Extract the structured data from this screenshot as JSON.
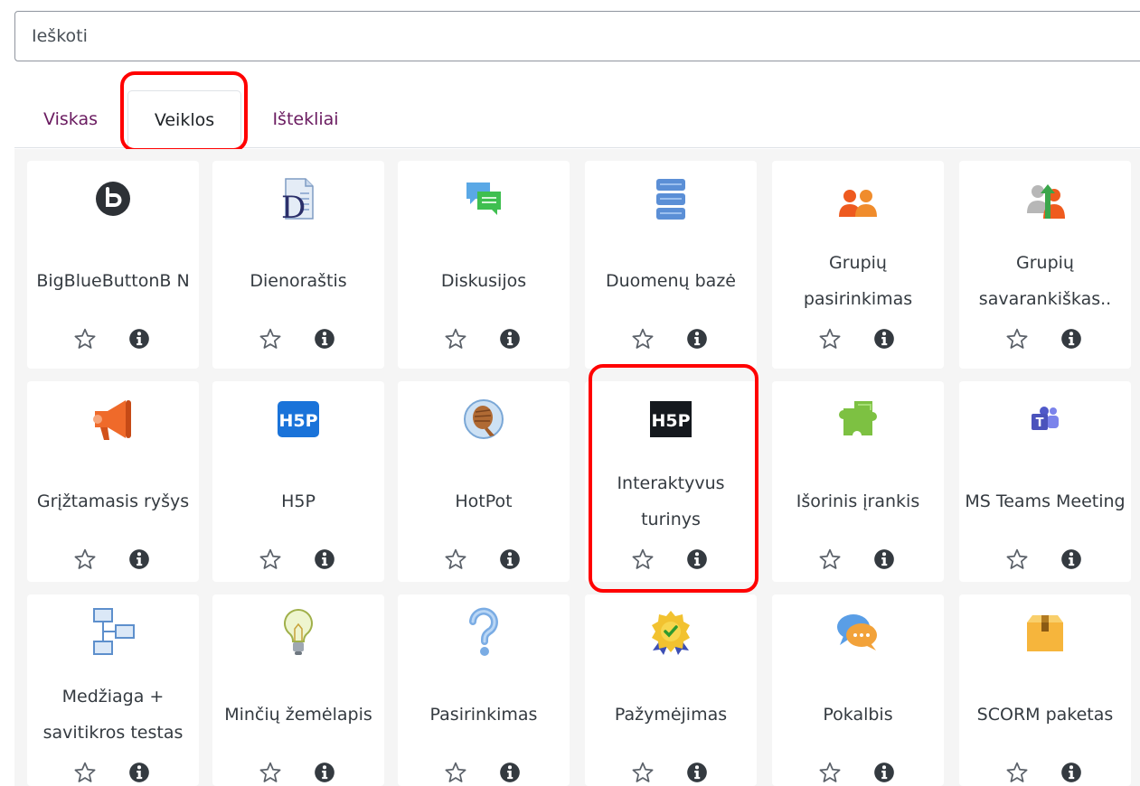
{
  "search": {
    "placeholder": "Ieškoti",
    "value": ""
  },
  "tabs": [
    {
      "label": "Viskas",
      "active": false
    },
    {
      "label": "Veiklos",
      "active": true
    },
    {
      "label": "Ištekliai",
      "active": false
    }
  ],
  "activities": [
    {
      "name": "BigBlueButtonB N",
      "icon": "bigbluebutton-icon"
    },
    {
      "name": "Dienoraštis",
      "icon": "journal-icon"
    },
    {
      "name": "Diskusijos",
      "icon": "forum-icon"
    },
    {
      "name": "Duomenų bazė",
      "icon": "database-icon"
    },
    {
      "name": "Grupių pasirinkimas",
      "icon": "group-choice-icon"
    },
    {
      "name": "Grupių savarankiškas..",
      "icon": "group-selfselect-icon"
    },
    {
      "name": "Grįžtamasis ryšys",
      "icon": "megaphone-icon"
    },
    {
      "name": "H5P",
      "icon": "h5p-icon"
    },
    {
      "name": "HotPot",
      "icon": "hotpot-icon"
    },
    {
      "name": "Interaktyvus turinys",
      "icon": "h5p-dark-icon"
    },
    {
      "name": "Išorinis įrankis",
      "icon": "puzzle-icon"
    },
    {
      "name": "MS Teams Meeting",
      "icon": "teams-icon"
    },
    {
      "name": "Medžiaga + savitikros testas",
      "icon": "flowchart-icon"
    },
    {
      "name": "Minčių žemėlapis",
      "icon": "lightbulb-icon"
    },
    {
      "name": "Pasirinkimas",
      "icon": "question-icon"
    },
    {
      "name": "Pažymėjimas",
      "icon": "certificate-icon"
    },
    {
      "name": "Pokalbis",
      "icon": "chat-icon"
    },
    {
      "name": "SCORM paketas",
      "icon": "package-icon"
    }
  ],
  "accent_colors": {
    "link": "#6a1b60",
    "highlight": "#ff0000"
  }
}
